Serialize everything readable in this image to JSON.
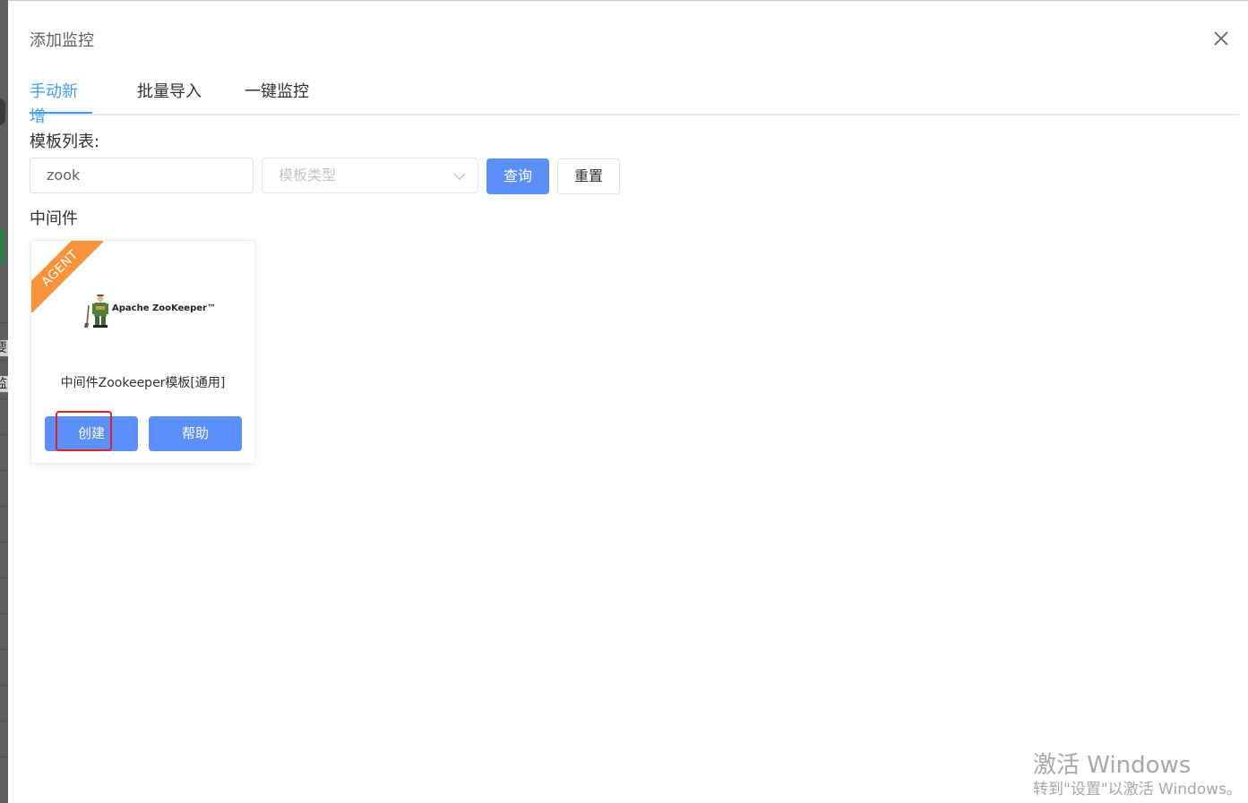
{
  "dialog": {
    "title": "添加监控"
  },
  "tabs": [
    {
      "label": "手动新增",
      "active": true
    },
    {
      "label": "批量导入",
      "active": false
    },
    {
      "label": "一键监控",
      "active": false
    }
  ],
  "filters": {
    "list_label": "模板列表:",
    "search_value": "zook",
    "type_placeholder": "模板类型",
    "query_label": "查询",
    "reset_label": "重置"
  },
  "category": {
    "title": "中间件"
  },
  "card": {
    "badge": "AGENT",
    "logo_text": "Apache ZooKeeper™",
    "name": "中间件Zookeeper模板[通用]",
    "create_label": "创建",
    "help_label": "帮助"
  },
  "background_fragments": [
    "要",
    "监"
  ],
  "watermark": {
    "line1": "激活 Windows",
    "line2": "转到\"设置\"以激活 Windows。"
  },
  "colors": {
    "accent": "#409eff",
    "button": "#5b8ff9",
    "badge": "#f7933b",
    "highlight": "#e02020"
  }
}
